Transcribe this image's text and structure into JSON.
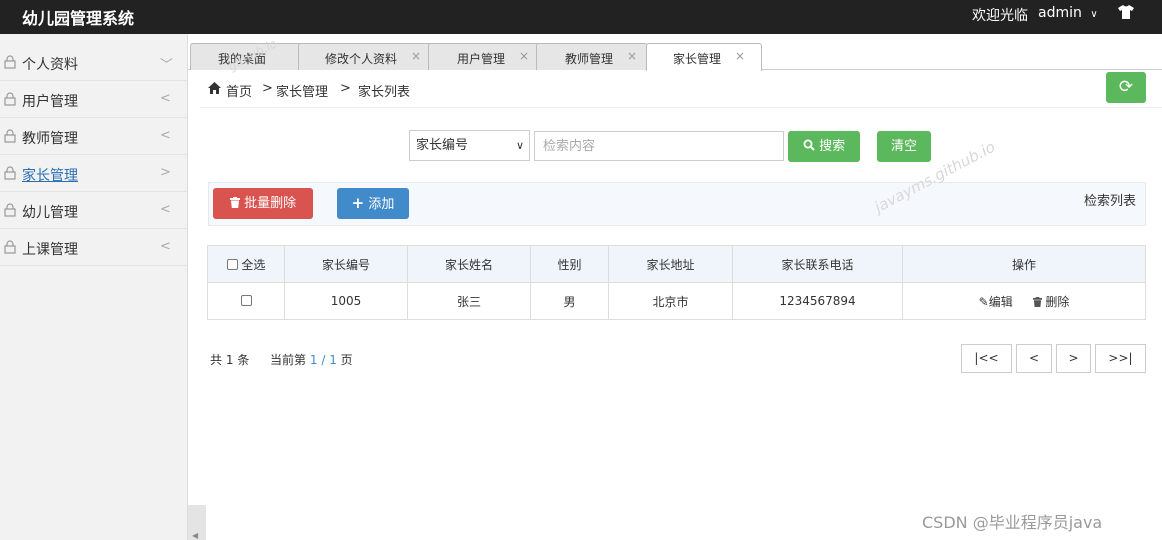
{
  "topbar": {
    "title": "幼儿园管理系统",
    "welcome": "欢迎光临",
    "user": "admin",
    "icons": {
      "user_menu": "chevron-down-icon",
      "theme": "tshirt-icon"
    }
  },
  "sidebar": {
    "items": [
      {
        "label": "个人资料",
        "arrow": "﹀"
      },
      {
        "label": "用户管理",
        "arrow": "<"
      },
      {
        "label": "教师管理",
        "arrow": "<"
      },
      {
        "label": "家长管理",
        "arrow": ">"
      },
      {
        "label": "幼儿管理",
        "arrow": "<"
      },
      {
        "label": "上课管理",
        "arrow": "<"
      }
    ],
    "active_index": 3
  },
  "tabs": [
    {
      "label": "我的桌面"
    },
    {
      "label": "修改个人资料"
    },
    {
      "label": "用户管理"
    },
    {
      "label": "教师管理"
    },
    {
      "label": "家长管理",
      "active": true
    }
  ],
  "breadcrumb": {
    "home": "首页",
    "separator": ">",
    "section": "家长管理",
    "page": "家长列表"
  },
  "search": {
    "field_selected": "家长编号",
    "placeholder": "检索内容",
    "search_label": "搜索",
    "clear_label": "清空"
  },
  "toolbar": {
    "batch_delete_label": "批量删除",
    "add_label": "添加",
    "list_title": "检索列表"
  },
  "table": {
    "select_all_label": "全选",
    "columns": [
      "家长编号",
      "家长姓名",
      "性别",
      "家长地址",
      "家长联系电话",
      "操作"
    ],
    "rows": [
      {
        "id": "1005",
        "name": "张三",
        "gender": "男",
        "address": "北京市",
        "phone": "1234567894"
      }
    ],
    "edit_label": "编辑",
    "delete_label": "删除"
  },
  "pagination": {
    "total_prefix": "共",
    "total": "1",
    "total_suffix": "条",
    "page_prefix": "当前第",
    "current": "1",
    "page_sep": "/",
    "pages": "1",
    "page_suffix": "页",
    "first": "|<<",
    "prev": "<",
    "next": ">",
    "last": ">>|"
  },
  "watermark": {
    "text1": "javayms.github.io",
    "text2": "github.io"
  },
  "credit": "CSDN @毕业程序员java",
  "colors": {
    "success": "#5cb85c",
    "danger": "#d9534f",
    "primary": "#428bca",
    "topbar": "#222222"
  }
}
